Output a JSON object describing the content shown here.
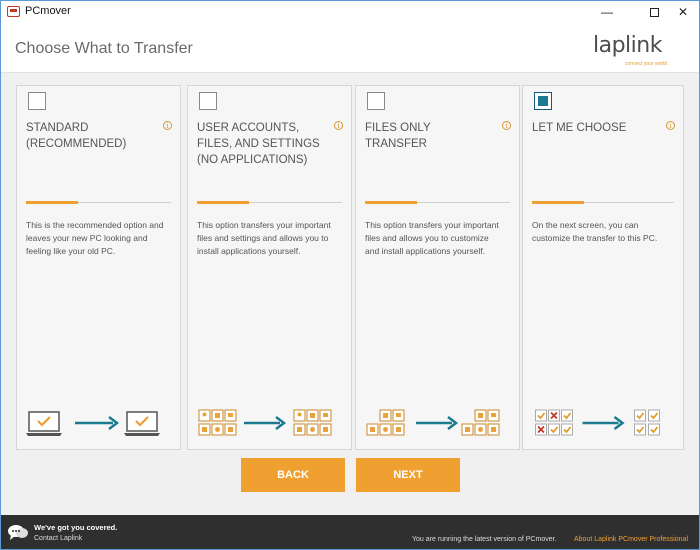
{
  "window": {
    "title": "PCmover"
  },
  "header": {
    "page_title": "Choose What to Transfer",
    "logo_text": "laplink",
    "logo_tagline": "connect your world"
  },
  "cards": [
    {
      "title": "STANDARD (RECOMMENDED)",
      "checked": false,
      "description": "This is the recommended option and leaves your new PC looking and feeling like your old PC."
    },
    {
      "title": "USER ACCOUNTS, FILES, AND SETTINGS (NO APPLICATIONS)",
      "checked": false,
      "description": "This option transfers your important files and settings and allows you to install applications yourself."
    },
    {
      "title": "FILES ONLY TRANSFER",
      "checked": false,
      "description": "This option transfers your important files and allows you to customize and install applications yourself."
    },
    {
      "title": "LET ME CHOOSE",
      "checked": true,
      "description": "On the next screen, you can customize the transfer to this PC."
    }
  ],
  "buttons": {
    "back": "BACK",
    "next": "NEXT"
  },
  "footer": {
    "tagline": "We've got you covered.",
    "contact": "Contact Laplink",
    "status": "You are running the latest version of PCmover.",
    "about_link": "About Laplink PCmover Professional"
  },
  "colors": {
    "accent": "#f0a030",
    "teal": "#1b7a8f",
    "footer_bg": "#2f2f2f"
  }
}
